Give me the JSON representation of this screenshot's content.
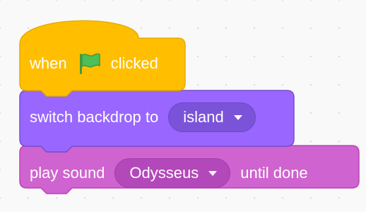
{
  "blocks": {
    "event": {
      "prefix": "when",
      "icon": "green-flag-icon",
      "suffix": "clicked",
      "color": "#FFBF00",
      "border": "#E6AC00"
    },
    "looks": {
      "label": "switch backdrop to",
      "dropdown_value": "island",
      "color": "#9966FF",
      "border": "#774DCB"
    },
    "sound": {
      "label": "play sound",
      "dropdown_value": "Odysseus",
      "suffix": "until done",
      "color": "#CF63CF",
      "border": "#BD42BD"
    }
  },
  "flag_color": "#4CBF56"
}
